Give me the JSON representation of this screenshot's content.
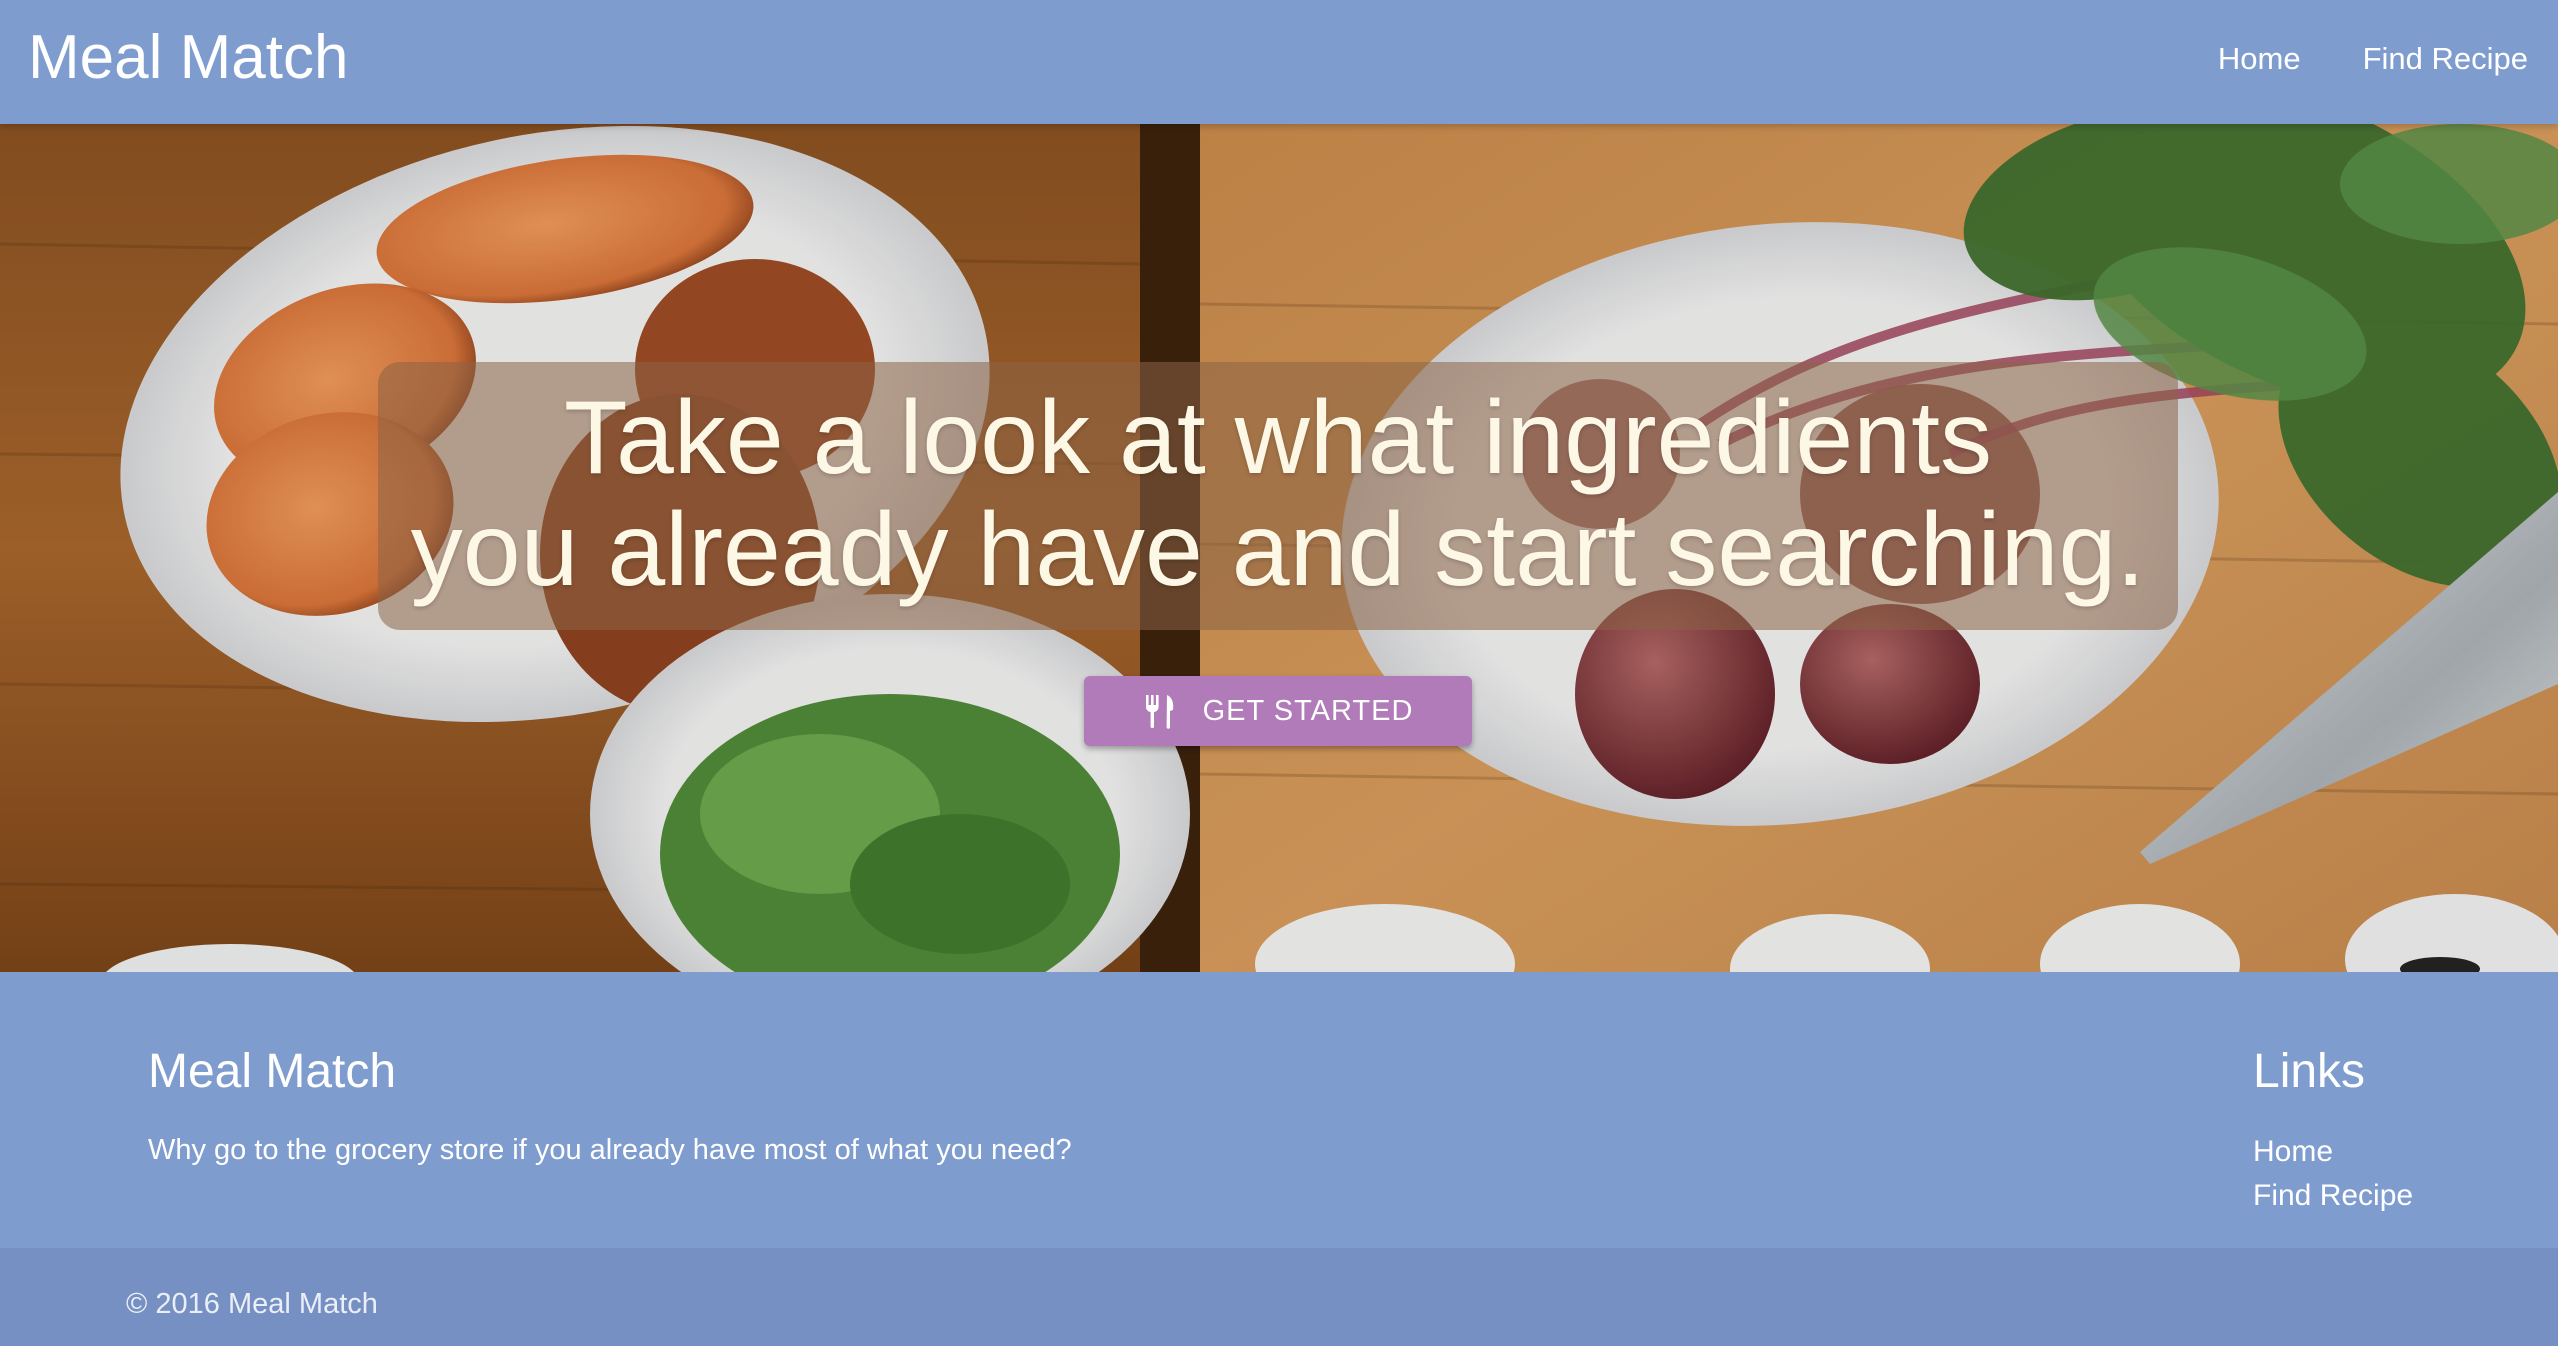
{
  "colors": {
    "primary": "#7f9ccf",
    "footer_copyright_bg": "#7690c3",
    "cta_button": "#b07bb8",
    "caption_text": "#fdf7e6"
  },
  "navbar": {
    "brand": "Meal Match",
    "links": [
      {
        "label": "Home"
      },
      {
        "label": "Find Recipe"
      }
    ]
  },
  "hero": {
    "caption_line_1": "Take a look at what ingredients",
    "caption_line_2": "you already have and start searching.",
    "cta": {
      "icon": "fork-knife-icon",
      "label": "GET STARTED"
    }
  },
  "footer": {
    "title": "Meal Match",
    "tagline": "Why go to the grocery store if you already have most of what you need?",
    "links_title": "Links",
    "links": [
      {
        "label": "Home"
      },
      {
        "label": "Find Recipe"
      }
    ],
    "copyright": "© 2016 Meal Match"
  }
}
